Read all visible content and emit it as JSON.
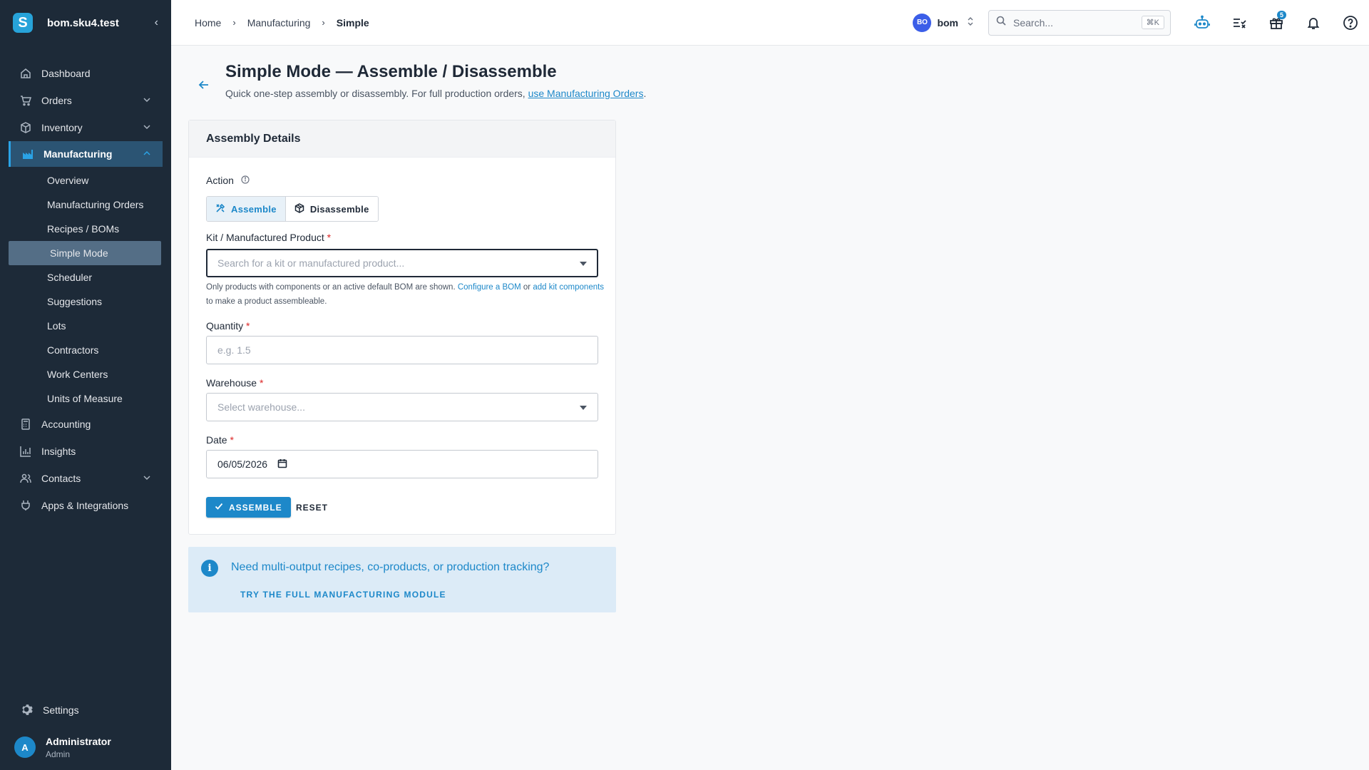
{
  "app": {
    "workspace": "bom.sku4.test",
    "logo_letter": "S",
    "collapse_glyph": "‹"
  },
  "sidebar": {
    "items": [
      {
        "label": "Dashboard",
        "icon": "home-icon"
      },
      {
        "label": "Orders",
        "icon": "cart-icon"
      },
      {
        "label": "Inventory",
        "icon": "box-icon"
      },
      {
        "label": "Manufacturing",
        "icon": "factory-icon"
      },
      {
        "label": "Accounting",
        "icon": "calculator-icon"
      },
      {
        "label": "Insights",
        "icon": "bar-chart-icon"
      },
      {
        "label": "Contacts",
        "icon": "people-icon"
      },
      {
        "label": "Apps & Integrations",
        "icon": "plug-icon"
      }
    ],
    "manufacturing_sub": [
      "Overview",
      "Manufacturing Orders",
      "Recipes / BOMs",
      "Simple Mode",
      "Scheduler",
      "Suggestions",
      "Lots",
      "Contractors",
      "Work Centers",
      "Units of Measure"
    ],
    "settings_label": "Settings",
    "user": {
      "initial": "A",
      "name": "Administrator",
      "role": "Admin"
    }
  },
  "topbar": {
    "breadcrumbs": [
      "Home",
      "Manufacturing",
      "Simple"
    ],
    "org_badge": "BO",
    "org_name": "bom",
    "search_placeholder": "Search...",
    "search_shortcut": "⌘K",
    "gift_badge_count": "5"
  },
  "page": {
    "title": "Simple Mode — Assemble / Disassemble",
    "subtitle_prefix": "Quick one-step assembly or disassembly. For full production orders, ",
    "subtitle_link": "use Manufacturing Orders",
    "subtitle_suffix": "."
  },
  "form": {
    "card_title": "Assembly Details",
    "action_label": "Action",
    "action_options": [
      "Assemble",
      "Disassemble"
    ],
    "action_selected": "Assemble",
    "product_label": "Kit / Manufactured Product",
    "product_placeholder": "Search for a kit or manufactured product...",
    "help_prefix": "Only products with components or an active default BOM are shown. ",
    "help_link1": "Configure a BOM",
    "help_mid": " or ",
    "help_link2": "add kit components",
    "help_suffix": " to make a product assembleable.",
    "quantity_label": "Quantity",
    "quantity_placeholder": "e.g. 1.5",
    "warehouse_label": "Warehouse",
    "warehouse_placeholder": "Select warehouse...",
    "date_label": "Date",
    "date_value": "06/05/2026",
    "required_mark": "*",
    "submit_label": "ASSEMBLE",
    "reset_label": "RESET"
  },
  "banner": {
    "text": "Need multi-output recipes, co-products, or production tracking?",
    "link": "TRY THE FULL MANUFACTURING MODULE"
  },
  "colors": {
    "sidebar_bg": "#1d2a38",
    "accent": "#1d88c9",
    "banner_bg": "#dcebf7",
    "required": "#dc2626"
  }
}
